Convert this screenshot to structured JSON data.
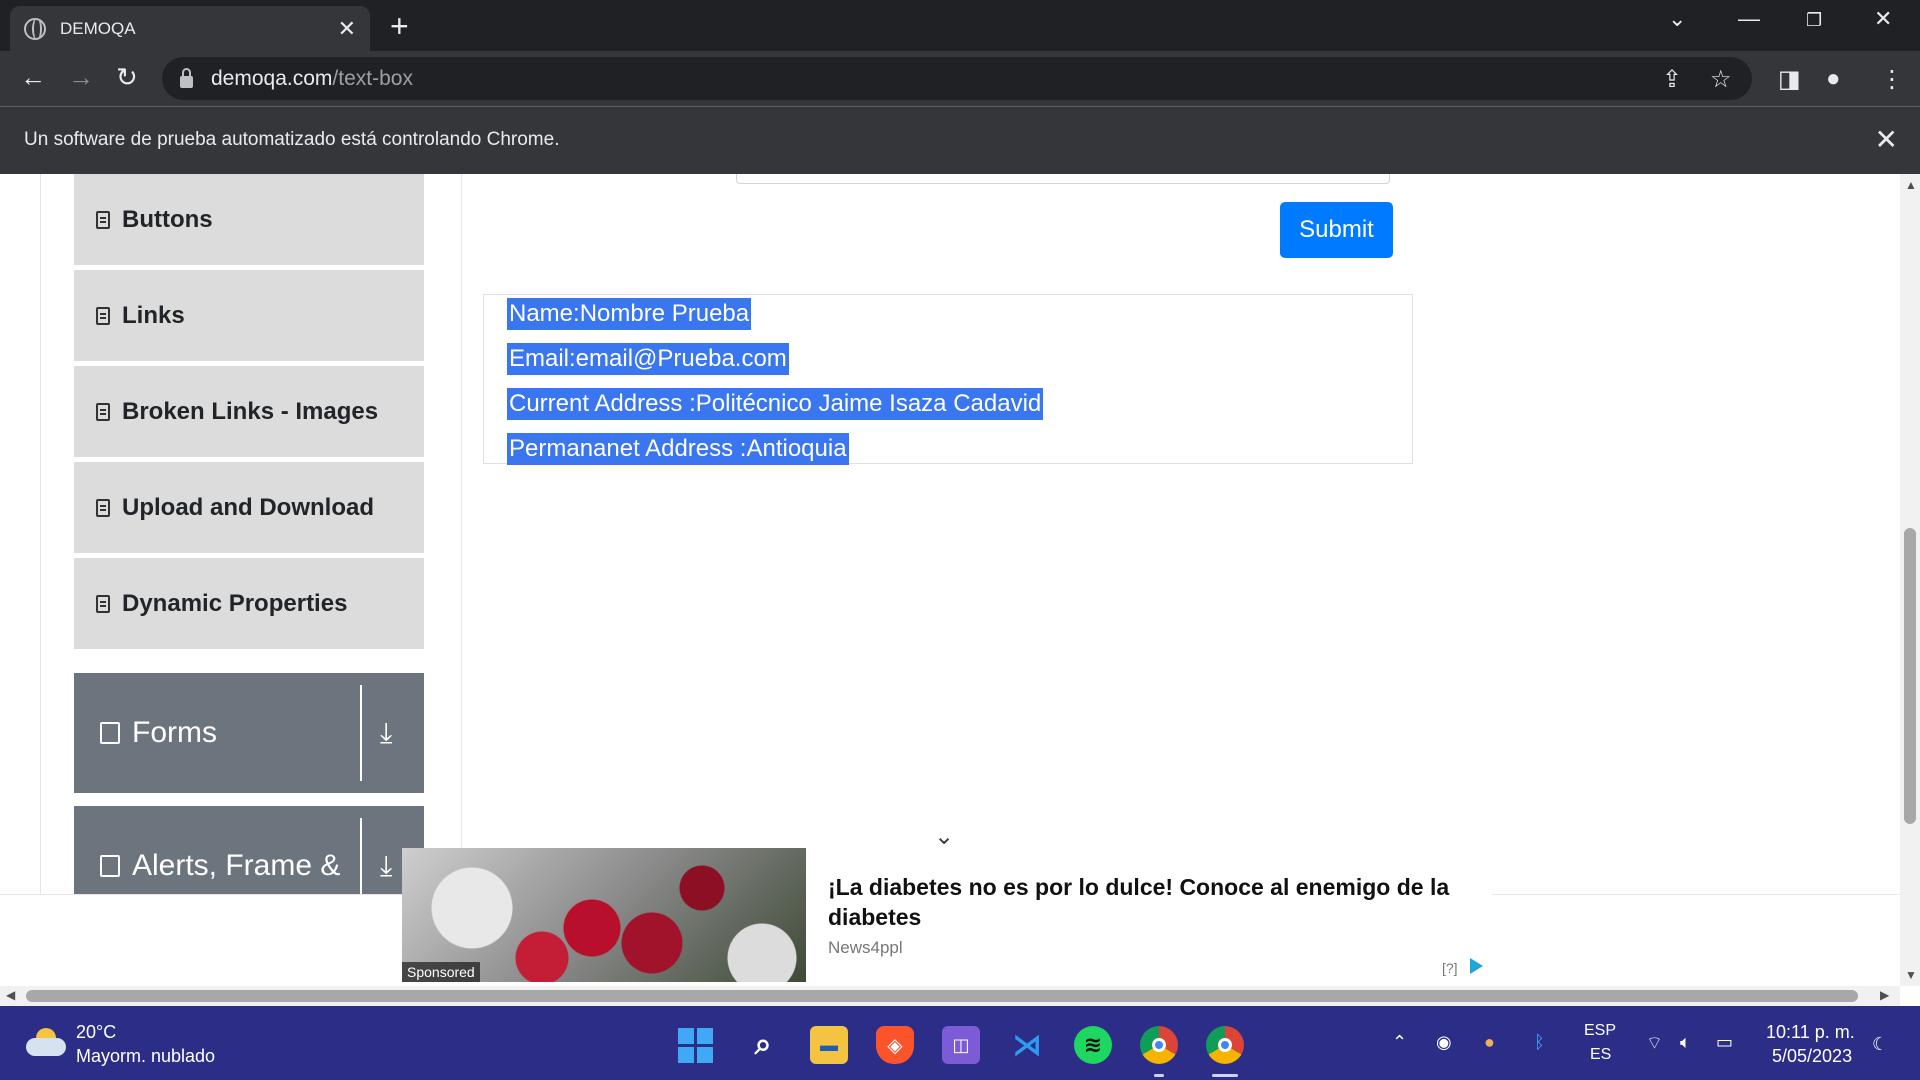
{
  "browser": {
    "tab_title": "DEMOQA",
    "url_host": "demoqa.com",
    "url_path": "/text-box",
    "infobar_message": "Un software de prueba automatizado está controlando Chrome."
  },
  "sidebar": {
    "items": [
      {
        "label": "Buttons"
      },
      {
        "label": "Links"
      },
      {
        "label": "Broken Links - Images"
      },
      {
        "label": "Upload and Download"
      },
      {
        "label": "Dynamic Properties"
      }
    ],
    "groups": [
      {
        "label": "Forms"
      },
      {
        "label": "Alerts, Frame &"
      }
    ]
  },
  "form": {
    "submit_label": "Submit"
  },
  "output": {
    "name": "Name:Nombre Prueba",
    "email": "Email:email@Prueba.com",
    "current_address": "Current Address :Politécnico Jaime Isaza Cadavid",
    "permanent_address": "Permananet Address :Antioquia"
  },
  "ad": {
    "sponsored": "Sponsored",
    "title": "¡La diabetes no es por lo dulce! Conoce al enemigo de la diabetes",
    "source": "News4ppl",
    "info": "[?]"
  },
  "taskbar": {
    "temperature": "20°C",
    "weather": "Mayorm. nublado",
    "lang_top": "ESP",
    "lang_bottom": "ES",
    "time": "10:11 p. m.",
    "date": "5/05/2023"
  },
  "colors": {
    "accent": "#007bff",
    "selection": "#3a76f0",
    "taskbar": "#2b2d87",
    "group_header": "#6c757d",
    "menu_item": "#dcdcdc"
  }
}
